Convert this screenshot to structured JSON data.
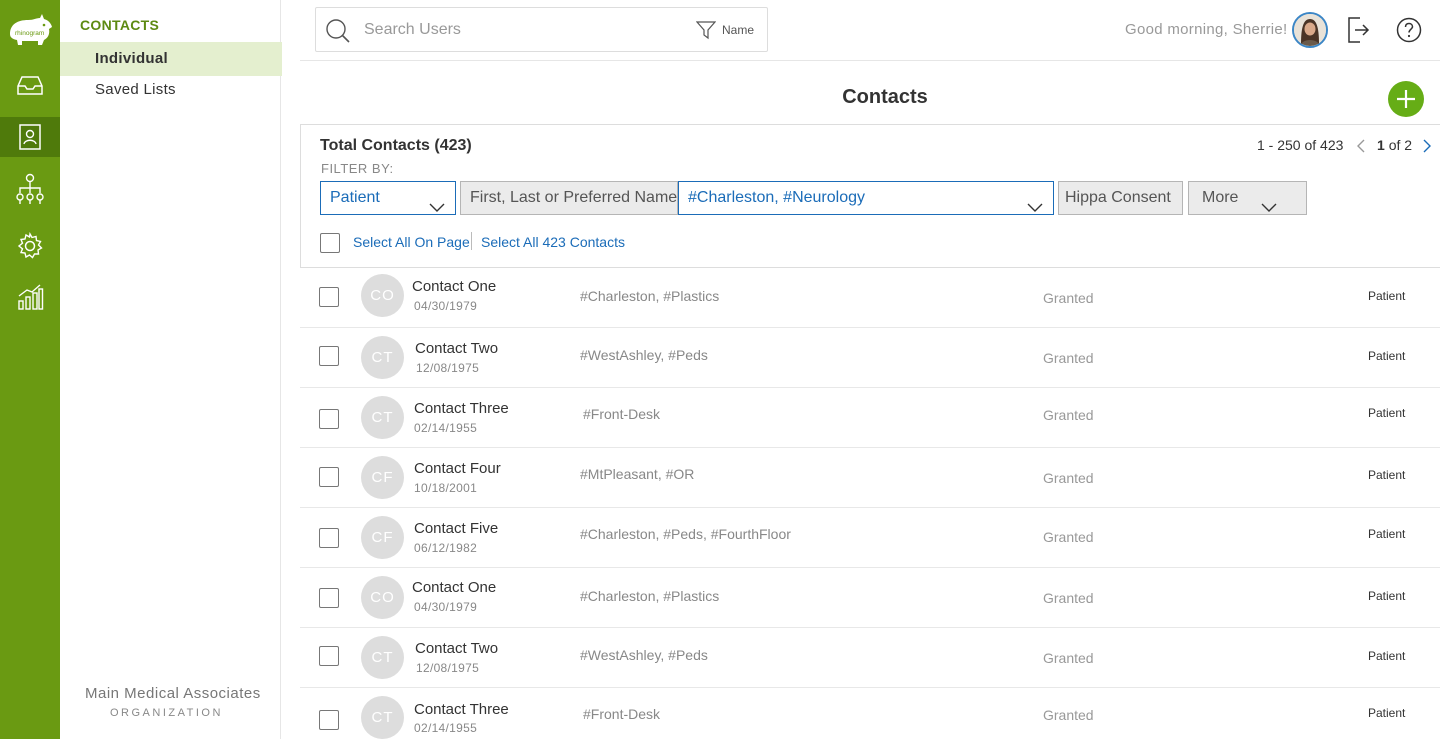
{
  "sidebar": {
    "section_title": "CONTACTS",
    "items": [
      {
        "label": "Individual"
      },
      {
        "label": "Saved Lists"
      }
    ],
    "org_name": "Main Medical Associates",
    "org_label": "ORGANIZATION",
    "nav_icons": [
      "inbox-icon",
      "contacts-icon",
      "org-chart-icon",
      "settings-icon",
      "analytics-icon"
    ]
  },
  "header": {
    "search_placeholder": "Search Users",
    "search_filter_label": "Name",
    "greeting": "Good morning, Sherrie!"
  },
  "page": {
    "title": "Contacts"
  },
  "filters": {
    "total": "Total Contacts (423)",
    "filter_by": "FILTER BY:",
    "type_select": "Patient",
    "name_field": "First, Last or Preferred Name",
    "tags_select": "#Charleston, #Neurology",
    "consent_select": "Hippa Consent",
    "more_select": "More",
    "select_all_page": "Select All On Page",
    "select_all_contacts": "Select All 423 Contacts"
  },
  "pager": {
    "range": "1 - 250 of 423",
    "current": "1",
    "of_total": "of 2"
  },
  "contacts": [
    {
      "initials": "CO",
      "name": "Contact One",
      "dob": "04/30/1979",
      "tags": "#Charleston, #Plastics",
      "consent": "Granted",
      "type": "Patient"
    },
    {
      "initials": "CT",
      "name": "Contact Two",
      "dob": "12/08/1975",
      "tags": "#WestAshley, #Peds",
      "consent": "Granted",
      "type": "Patient"
    },
    {
      "initials": "CT",
      "name": "Contact Three",
      "dob": "02/14/1955",
      "tags": "#Front-Desk",
      "consent": "Granted",
      "type": "Patient"
    },
    {
      "initials": "CF",
      "name": "Contact Four",
      "dob": "10/18/2001",
      "tags": "#MtPleasant, #OR",
      "consent": "Granted",
      "type": "Patient"
    },
    {
      "initials": "CF",
      "name": "Contact Five",
      "dob": "06/12/1982",
      "tags": "#Charleston, #Peds, #FourthFloor",
      "consent": "Granted",
      "type": "Patient"
    },
    {
      "initials": "CO",
      "name": "Contact One",
      "dob": "04/30/1979",
      "tags": "#Charleston, #Plastics",
      "consent": "Granted",
      "type": "Patient"
    },
    {
      "initials": "CT",
      "name": "Contact Two",
      "dob": "12/08/1975",
      "tags": "#WestAshley, #Peds",
      "consent": "Granted",
      "type": "Patient"
    },
    {
      "initials": "CT",
      "name": "Contact Three",
      "dob": "02/14/1955",
      "tags": "#Front-Desk",
      "consent": "Granted",
      "type": "Patient"
    }
  ]
}
